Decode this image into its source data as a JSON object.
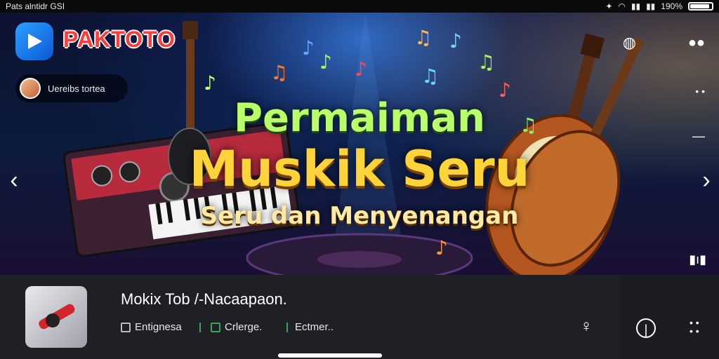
{
  "status_bar": {
    "left_text": "Pats alntidr GSI",
    "right_text": "190%",
    "battery_level": 0.9,
    "icons": [
      "notification-icon",
      "wifi-icon",
      "signal-icon",
      "signal-icon",
      "battery-icon"
    ]
  },
  "banner": {
    "brand": "PAKTOTO",
    "user_name": "Uereibs tortea",
    "headline_1": "Permaiman",
    "headline_2": "Muskik Seru",
    "headline_3": "Seru dan Menyenangan"
  },
  "app_card": {
    "title": "Mokix Tob /-Nacaapaon.",
    "meta": [
      {
        "icon": "category-icon",
        "label": "Entignesa"
      },
      {
        "icon": "tag-icon",
        "label": "Crlerge."
      },
      {
        "icon": "text-icon",
        "label": "Ectmer.."
      }
    ]
  },
  "colors": {
    "accent_green": "#b8ff6a",
    "accent_yellow": "#ffd43b",
    "brand_red": "#ff3b3b"
  }
}
